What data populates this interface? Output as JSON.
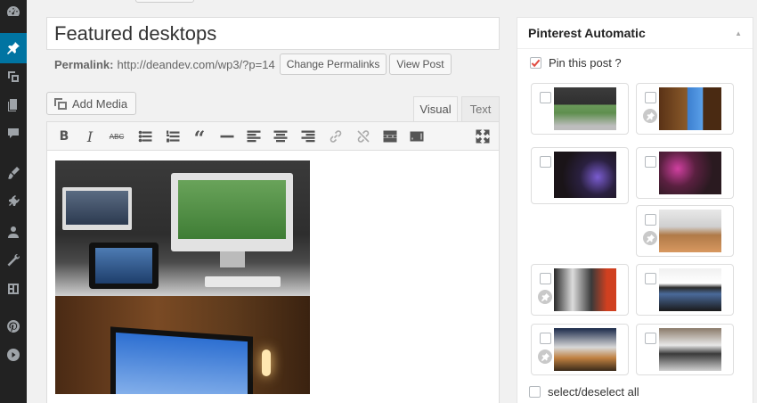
{
  "sidebar": {
    "icons": [
      "dashboard-icon",
      "pin-icon",
      "media-icon",
      "pages-icon",
      "comments-icon",
      "appearance-icon",
      "plugins-icon",
      "users-icon",
      "tools-icon",
      "settings-icon",
      "pinterest-icon",
      "play-icon"
    ],
    "active_index": 1
  },
  "post": {
    "title": "Featured desktops",
    "permalink_label": "Permalink:",
    "permalink_url": "http://deandev.com/wp3/?p=14",
    "change_permalinks_label": "Change Permalinks",
    "view_post_label": "View Post"
  },
  "editor": {
    "add_media_label": "Add Media",
    "tab_visual": "Visual",
    "tab_text": "Text",
    "active_tab": "Visual",
    "toolbar": [
      "bold",
      "italic",
      "strikethrough",
      "bulleted-list",
      "numbered-list",
      "blockquote",
      "horizontal-line",
      "align-left",
      "align-center",
      "align-right",
      "insert-link",
      "remove-link",
      "read-more",
      "toolbar-toggle",
      "fullscreen"
    ]
  },
  "pinterest_panel": {
    "title": "Pinterest Automatic",
    "pin_this_post_label": "Pin this post ?",
    "pin_this_post_checked": true,
    "select_all_label": "select/deselect all",
    "thumbnails": [
      {
        "pinned": false,
        "checked": false
      },
      {
        "pinned": true,
        "checked": false
      },
      {
        "pinned": false,
        "checked": false
      },
      {
        "pinned": false,
        "checked": false
      },
      {
        "pinned": true,
        "checked": false
      },
      {
        "pinned": true,
        "checked": false
      },
      {
        "pinned": false,
        "checked": false
      },
      {
        "pinned": true,
        "checked": false
      },
      {
        "pinned": false,
        "checked": false
      }
    ]
  },
  "colors": {
    "sidebar_bg": "#222222",
    "active_item": "#0074a2",
    "checkbox_check": "#e14d43"
  }
}
